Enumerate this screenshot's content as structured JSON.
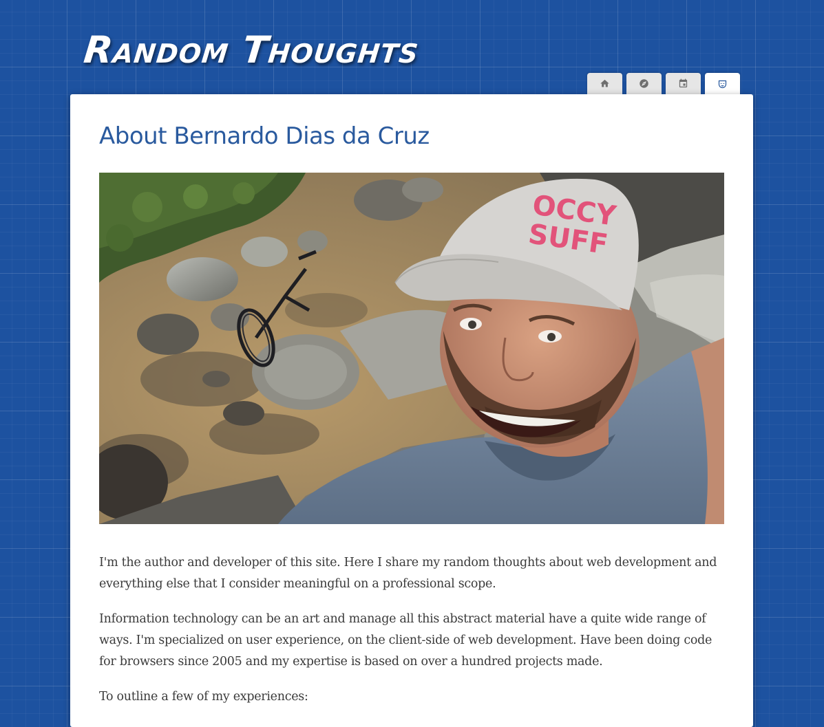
{
  "site": {
    "title": "Random Thoughts"
  },
  "nav": {
    "tabs": [
      {
        "icon": "home-icon",
        "active": false
      },
      {
        "icon": "compass-icon",
        "active": false
      },
      {
        "icon": "calendar-icon",
        "active": false
      },
      {
        "icon": "mask-icon",
        "active": true
      }
    ]
  },
  "page": {
    "heading": "About Bernardo Dias da Cruz",
    "paragraphs": [
      "I'm the author and developer of this site. Here I share my random thoughts about web development and everything else that I consider meaningful on a professional scope.",
      "Information technology can be an art and manage all this abstract material have a quite wide range of ways. I'm specialized on user experience, on the client-side of web development. Have been doing code for browsers since 2005 and my expertise is based on over a hundred projects made.",
      "To outline a few of my experiences:"
    ]
  },
  "photo": {
    "cap_text_line1": "OCCY",
    "cap_text_line2": "SUFF"
  },
  "colors": {
    "background": "#1d52a0",
    "accent": "#2a5a9e",
    "text": "#3a3a3a",
    "tab": "#e6e6e6"
  }
}
